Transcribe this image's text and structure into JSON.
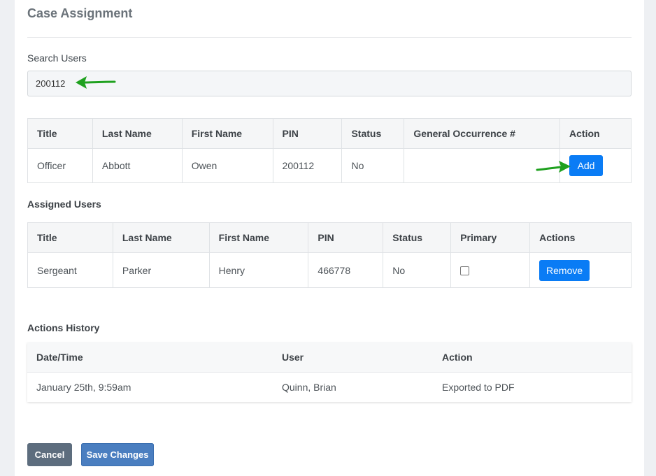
{
  "page": {
    "title": "Case Assignment"
  },
  "search": {
    "label": "Search Users",
    "value": "200112"
  },
  "results": {
    "headers": [
      "Title",
      "Last Name",
      "First Name",
      "PIN",
      "Status",
      "General Occurrence #",
      "Action"
    ],
    "rows": [
      {
        "title": "Officer",
        "last_name": "Abbott",
        "first_name": "Owen",
        "pin": "200112",
        "status": "No",
        "general_occurrence": "",
        "action_label": "Add"
      }
    ]
  },
  "assigned": {
    "section_title": "Assigned Users",
    "headers": [
      "Title",
      "Last Name",
      "First Name",
      "PIN",
      "Status",
      "Primary",
      "Actions"
    ],
    "rows": [
      {
        "title": "Sergeant",
        "last_name": "Parker",
        "first_name": "Henry",
        "pin": "466778",
        "status": "No",
        "primary": false,
        "action_label": "Remove"
      }
    ]
  },
  "history": {
    "section_title": "Actions History",
    "headers": [
      "Date/Time",
      "User",
      "Action"
    ],
    "rows": [
      {
        "datetime": "January 25th, 9:59am",
        "user": "Quinn, Brian",
        "action": "Exported to PDF"
      }
    ]
  },
  "footer": {
    "cancel_label": "Cancel",
    "save_label": "Save Changes"
  },
  "colors": {
    "primary": "#0a7cf5",
    "annotation_arrow": "#1fa11f",
    "save": "#4a7ec0",
    "cancel": "#5d6d7e"
  }
}
